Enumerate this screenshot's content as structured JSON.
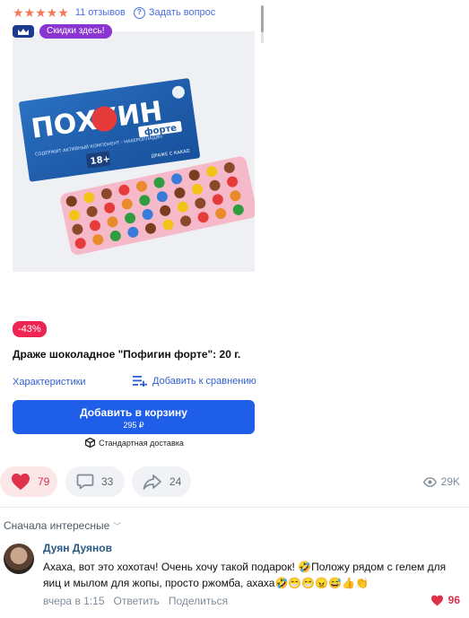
{
  "product": {
    "rating": 5,
    "reviews_label": "11 отзывов",
    "ask_label": "Задать вопрос",
    "sale_badge": "Скидки здесь!",
    "image_package_title": "ПОХУИН",
    "image_package_subtitle": "форте",
    "image_package_age": "18+",
    "image_package_caption": "ДРАЖЕ С КАКАО",
    "image_package_desc": "СОДЕРЖИТ АКТИВНЫЙ КОМПОНЕНТ - НАХЕРОПЛАДИН",
    "carousel_pages": 3,
    "carousel_active": 1,
    "discount": "-43%",
    "title": "Драже шоколадное \"Пофигин форте\": 20 г.",
    "characteristics_label": "Характеристики",
    "compare_label": "Добавить к сравнению",
    "cart_label": "Добавить в корзину",
    "cart_price": "295 ₽",
    "delivery_label": "Стандартная доставка"
  },
  "post_actions": {
    "likes": "79",
    "comments": "33",
    "shares": "24",
    "views": "29K"
  },
  "comments_section": {
    "sort_label": "Сначала интересные"
  },
  "comment": {
    "author": "Дуян Дуянов",
    "text": "Ахаха, вот это хохотач! Очень хочу такой подарок! 🤣Положу рядом с гелем для яиц и мылом для жопы, просто ржомба, ахаха🤣😁😁😠😅👍👏",
    "time": "вчера в 1:15",
    "reply_label": "Ответить",
    "share_label": "Поделиться",
    "likes": "96"
  },
  "colors": {
    "accent_blue": "#1f5ee8",
    "like_red": "#d8304c",
    "star_orange": "#f27a5b",
    "sale_purple": "#8a34d1",
    "discount_red": "#ee2453"
  },
  "icons": {
    "stars": "star-icon",
    "ask": "question-bubble-icon",
    "crown": "crown-icon",
    "compare": "compare-list-icon",
    "delivery": "box-icon",
    "like": "heart-icon",
    "comment": "comment-icon",
    "share": "share-arrow-icon",
    "views": "eye-icon"
  }
}
